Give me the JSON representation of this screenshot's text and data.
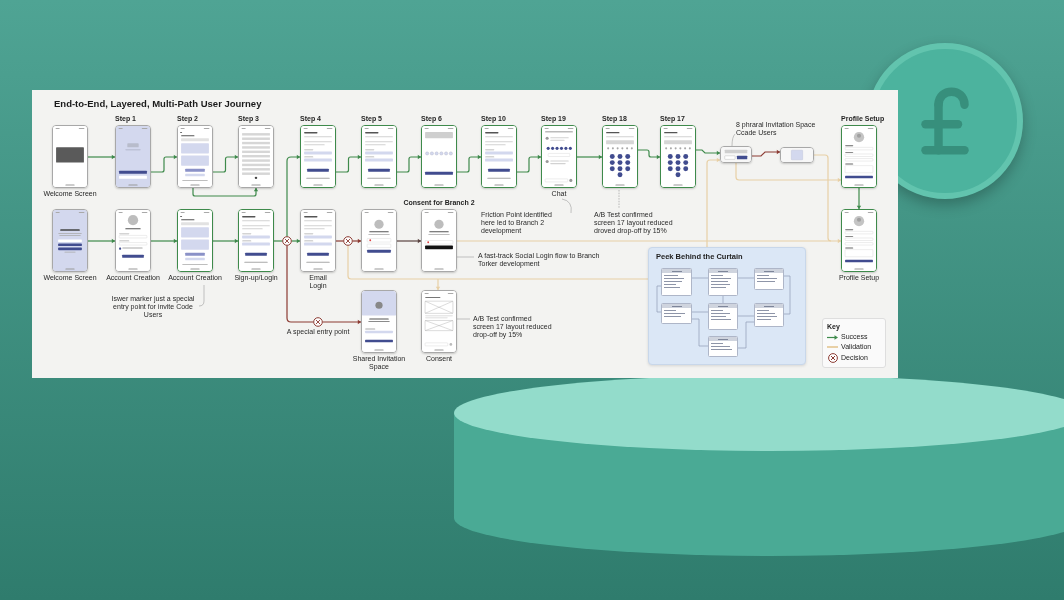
{
  "title": "End-to-End, Layered, Multi-Path User Journey",
  "screens": [
    {
      "kind": "image",
      "label": "Welcome Screen",
      "highlighted": false
    },
    {
      "kind": "splash",
      "step": "Step 1",
      "highlighted": false
    },
    {
      "kind": "cards",
      "step": "Step 2",
      "highlighted": false
    },
    {
      "kind": "text",
      "step": "Step 3",
      "highlighted": false
    },
    {
      "kind": "form",
      "step": "Step 4",
      "highlighted": true
    },
    {
      "kind": "form",
      "step": "Step 5",
      "highlighted": true
    },
    {
      "kind": "dots",
      "step": "Step 6",
      "highlighted": true
    },
    {
      "kind": "form",
      "step": "Step 10",
      "highlighted": true
    },
    {
      "kind": "chat",
      "step": "Step 19",
      "label": "Chat",
      "highlighted": true
    },
    {
      "kind": "keypad",
      "step": "Step 18",
      "highlighted": true
    },
    {
      "kind": "keypad",
      "step": "Step 17",
      "highlighted": true
    },
    {
      "kind": "modal",
      "highlighted": false
    },
    {
      "kind": "tile",
      "highlighted": false
    },
    {
      "kind": "profile",
      "step": "Profile Setup",
      "highlighted": true
    },
    {
      "kind": "welcome",
      "label": "Welcome Screen",
      "highlighted": false
    },
    {
      "kind": "account",
      "label": "Account Creation",
      "highlighted": false
    },
    {
      "kind": "cards",
      "label": "Account Creation",
      "highlighted": true
    },
    {
      "kind": "form",
      "label": "Sign-up/Login",
      "highlighted": true
    },
    {
      "kind": "form",
      "label": "Email Login",
      "highlighted": false
    },
    {
      "kind": "social",
      "highlighted": false
    },
    {
      "kind": "social-dark",
      "step": "Consent for Branch 2",
      "highlighted": false
    },
    {
      "kind": "profile",
      "label": "Profile Setup",
      "highlighted": true
    },
    {
      "kind": "invite",
      "label": "Shared Invitation Space",
      "highlighted": false
    },
    {
      "kind": "images",
      "label": "Consent",
      "highlighted": false
    }
  ],
  "annotations": [
    "8 phraral Invitation Space Ccade Users",
    "Friction Point identified here led to Branch 2 development",
    "A/B Test confirmed screen 17 layout reduced droved drop-off by 15%",
    "A fast-track Social Login flow to Branch Torker development",
    "Iswer marker just a special entry point for invite Code Users",
    "A special entry point",
    "A/B Test confirmed screen 17 layout reduced drop-off by 15%"
  ],
  "erd": {
    "title": "Peek Behind the Curtain"
  },
  "key": {
    "title": "Key",
    "items": [
      {
        "kind": "success",
        "label": "Success"
      },
      {
        "kind": "validation",
        "label": "Validation"
      },
      {
        "kind": "decision",
        "label": "Decision"
      }
    ]
  }
}
